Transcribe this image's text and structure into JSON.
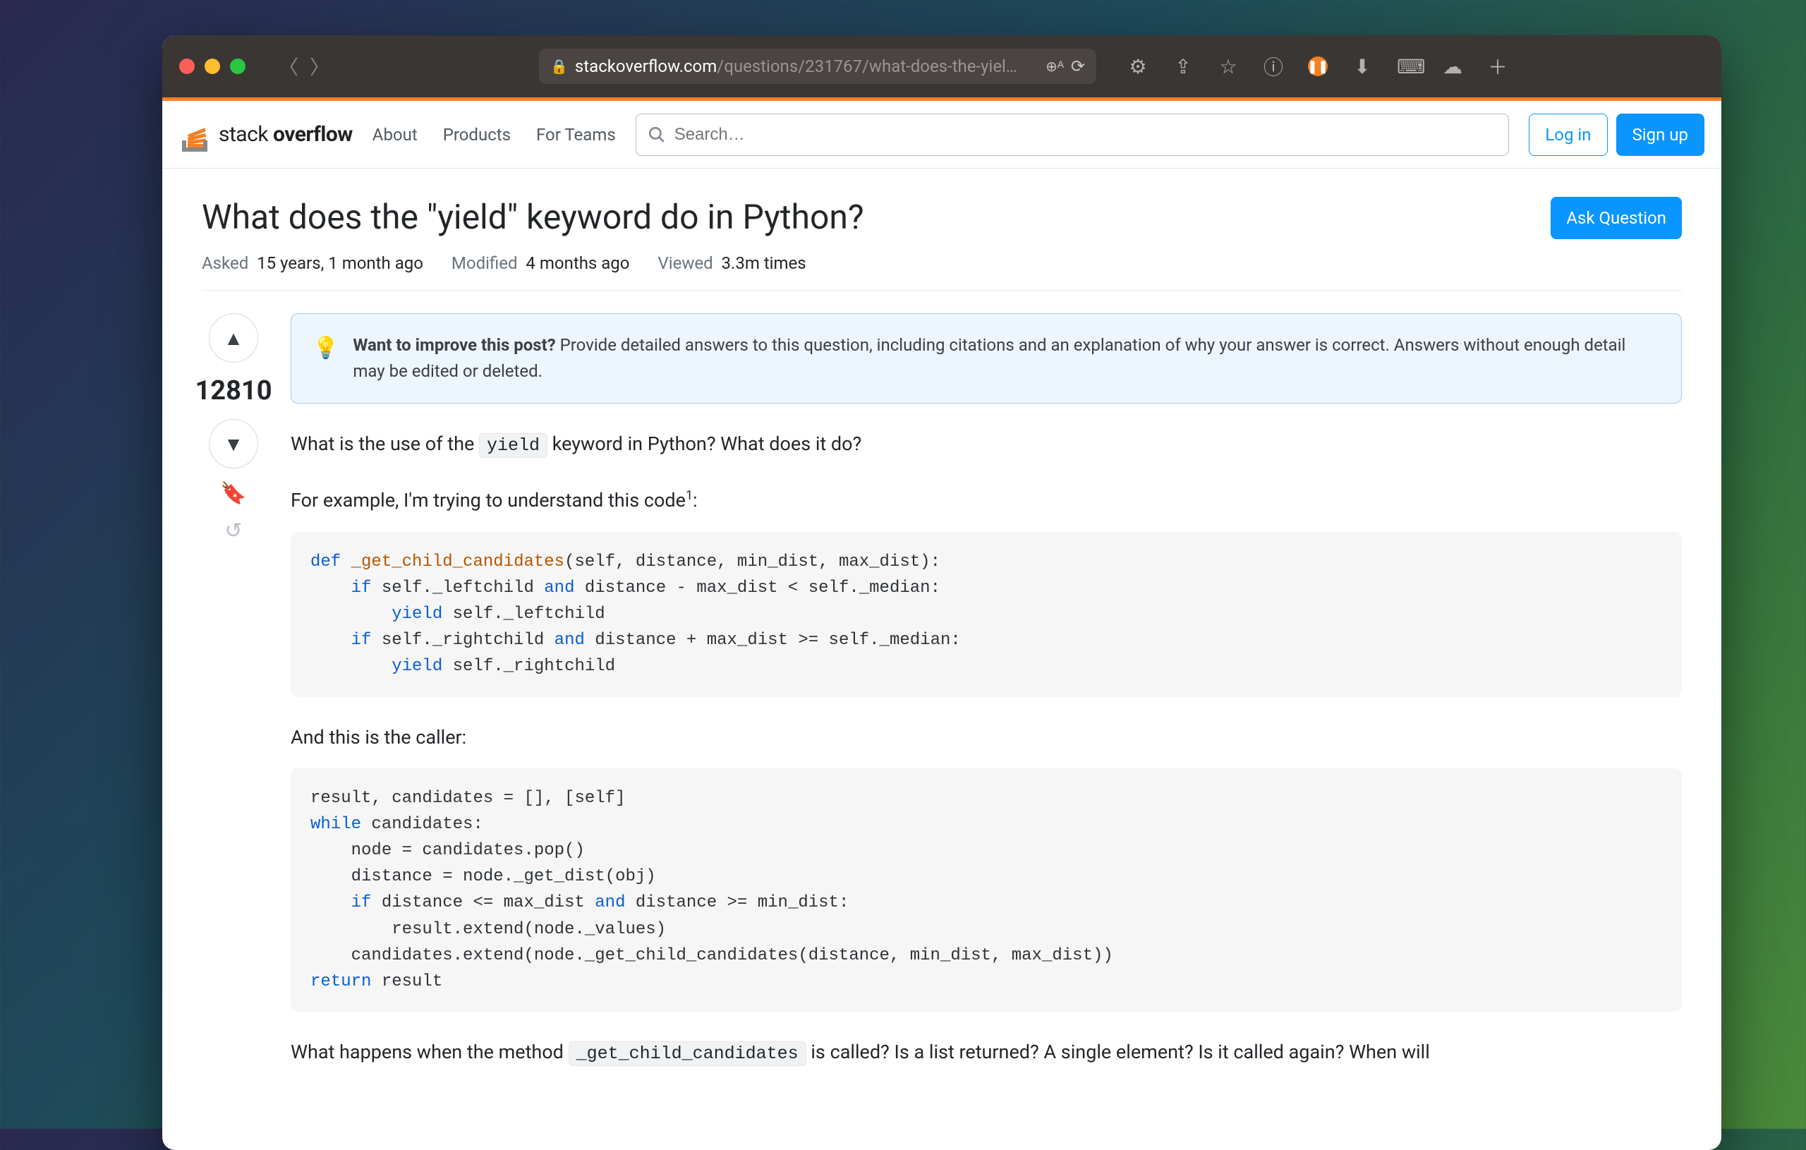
{
  "browser": {
    "url_domain": "stackoverflow.com",
    "url_path": "/questions/231767/what-does-the-yiel…"
  },
  "header": {
    "logo_text_a": "stack",
    "logo_text_b": "overflow",
    "nav": {
      "about": "About",
      "products": "Products",
      "teams": "For Teams"
    },
    "search_placeholder": "Search…",
    "login": "Log in",
    "signup": "Sign up"
  },
  "question": {
    "title": "What does the \"yield\" keyword do in Python?",
    "ask_button": "Ask Question",
    "meta": {
      "asked_label": "Asked",
      "asked_val": "15 years, 1 month ago",
      "modified_label": "Modified",
      "modified_val": "4 months ago",
      "viewed_label": "Viewed",
      "viewed_val": "3.3m times"
    },
    "score": "12810",
    "notice_lead": "Want to improve this post?",
    "notice_body": " Provide detailed answers to this question, including citations and an explanation of why your answer is correct. Answers without enough detail may be edited or deleted.",
    "p1_a": "What is the use of the ",
    "p1_code": "yield",
    "p1_b": " keyword in Python? What does it do?",
    "p2": "For example, I'm trying to understand this code",
    "p2_sup": "1",
    "p2_tail": ":",
    "p3": "And this is the caller:",
    "p4_a": "What happens when the method ",
    "p4_code": "_get_child_candidates",
    "p4_b": " is called? Is a list returned? A single element? Is it called again? When will"
  }
}
